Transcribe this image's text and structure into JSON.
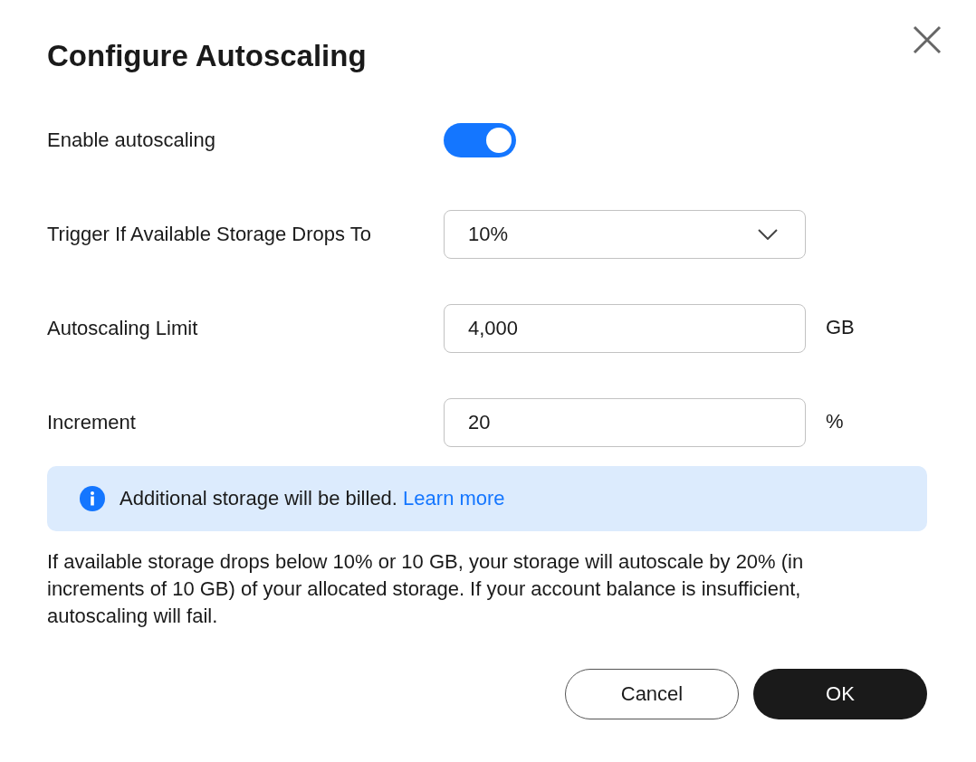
{
  "dialog": {
    "title": "Configure Autoscaling"
  },
  "fields": [
    {
      "kind": "toggle",
      "label": "Enable autoscaling",
      "on": true
    },
    {
      "kind": "select",
      "label": "Trigger If Available Storage Drops To",
      "value": "10%"
    },
    {
      "kind": "input",
      "label": "Autoscaling Limit",
      "value": "4,000",
      "unit": "GB"
    },
    {
      "kind": "input",
      "label": "Increment",
      "value": "20",
      "unit": "%"
    }
  ],
  "notice": {
    "text": "Additional storage will be billed.",
    "link": "Learn more"
  },
  "description": "If available storage drops below 10% or 10 GB, your storage will autoscale by 20% (in increments of 10 GB) of your allocated storage. If your account balance is insufficient, autoscaling will fail.",
  "buttons": [
    {
      "label": "Cancel",
      "kind": "secondary"
    },
    {
      "label": "OK",
      "kind": "primary"
    }
  ]
}
